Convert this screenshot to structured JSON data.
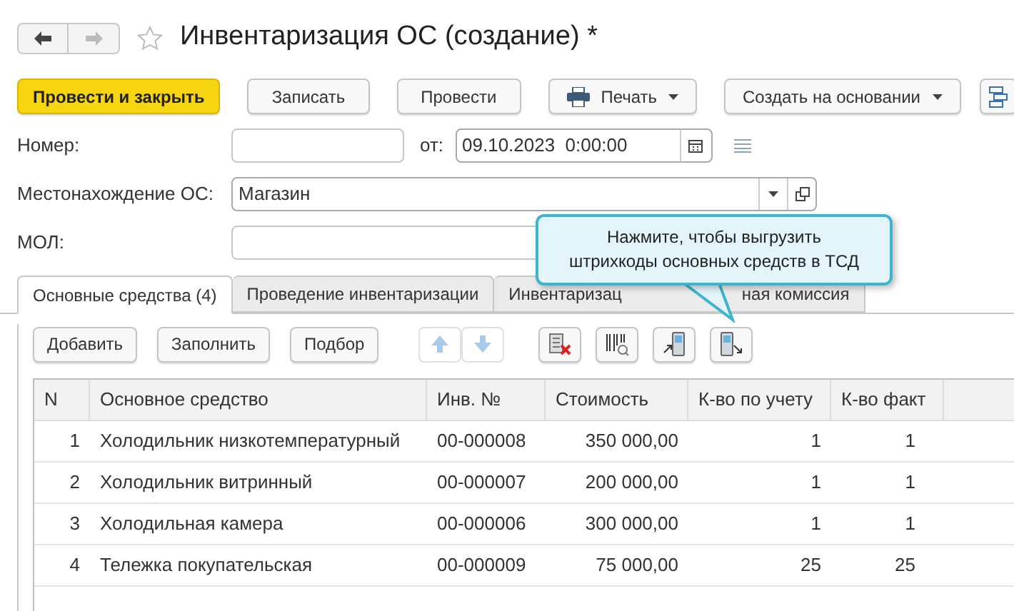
{
  "title": "Инвентаризация ОС (создание) *",
  "favorite": false,
  "command_bar": [
    {
      "label": "Провести и закрыть",
      "kind": "primary"
    },
    {
      "label": "Записать",
      "kind": "plain"
    },
    {
      "label": "Провести",
      "kind": "plain"
    },
    {
      "label": "Печать",
      "kind": "print"
    },
    {
      "label": "Создать на основании",
      "kind": "menu"
    },
    {
      "kind": "structure"
    }
  ],
  "number": {
    "label": "Номер:"
  },
  "date": {
    "label": "от:",
    "value": "09.10.2023  0:00:00"
  },
  "location": {
    "label": "Местонахождение ОС:",
    "value": "Магазин"
  },
  "mol": {
    "label": "МОЛ:"
  },
  "tabs": [
    {
      "label_start": "Основные средства (4)",
      "selected": true
    },
    {
      "label_start": "Проведение инвентаризации",
      "selected": false
    },
    {
      "label_start": "Инвентаризац",
      "label_end": "ная комиссия",
      "selected": false
    }
  ],
  "tooltip": "Нажмите, чтобы выгрузить штрихкоды основных средств в ТСД",
  "toolbar": [
    {
      "kind": "text",
      "label": "Добавить"
    },
    {
      "kind": "text",
      "label": "Заполнить"
    },
    {
      "kind": "text",
      "label": "Подбор"
    },
    {
      "kind": "up",
      "disabled": true
    },
    {
      "kind": "down",
      "disabled": true
    },
    {
      "kind": "clear"
    },
    {
      "kind": "barcode"
    },
    {
      "kind": "upload"
    },
    {
      "kind": "download"
    }
  ],
  "table": {
    "columns": [
      "N",
      "Основное средство",
      "Инв. №",
      "Стоимость",
      "К-во по учету",
      "К-во факт"
    ],
    "rows": [
      [
        "1",
        "Холодильник низкотемпературный",
        "00-000008",
        "350 000,00",
        "1",
        "1"
      ],
      [
        "2",
        "Холодильник витринный",
        "00-000007",
        "200 000,00",
        "1",
        "1"
      ],
      [
        "3",
        "Холодильная камера",
        "00-000006",
        "300 000,00",
        "1",
        "1"
      ],
      [
        "4",
        "Тележка покупательская",
        "00-000009",
        "75 000,00",
        "25",
        "25"
      ]
    ]
  }
}
